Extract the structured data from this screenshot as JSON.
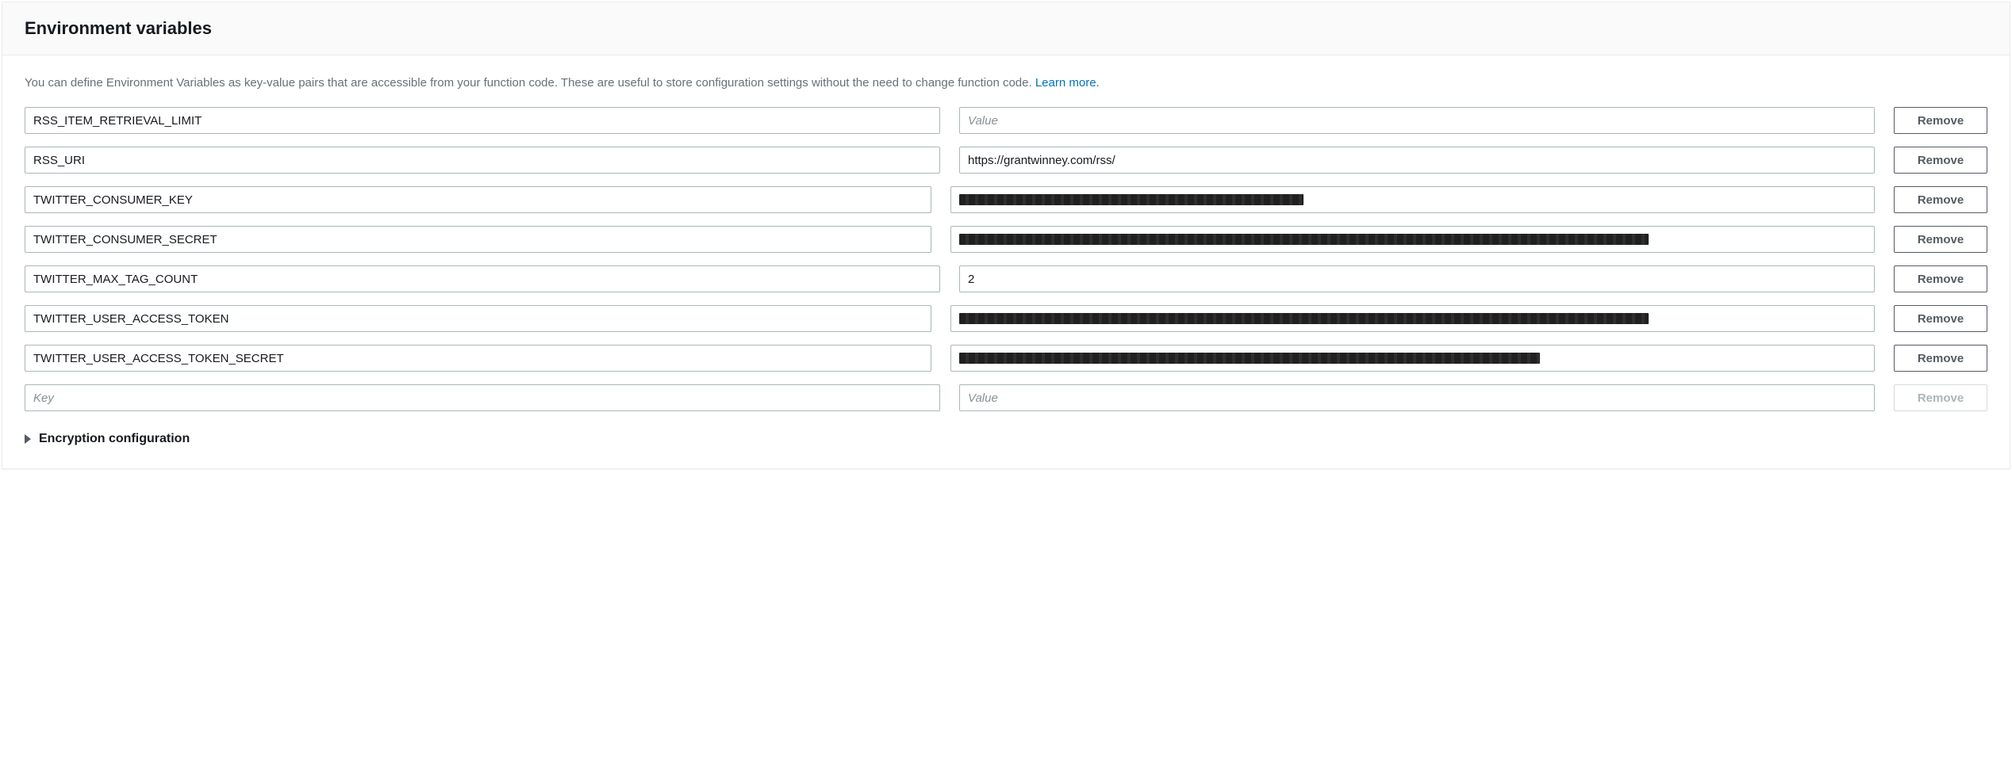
{
  "header": {
    "title": "Environment variables"
  },
  "description": {
    "text": "You can define Environment Variables as key-value pairs that are accessible from your function code. These are useful to store configuration settings without the need to change function code. ",
    "link_text": "Learn more."
  },
  "placeholders": {
    "key": "Key",
    "value": "Value"
  },
  "buttons": {
    "remove": "Remove"
  },
  "rows": [
    {
      "key": "RSS_ITEM_RETRIEVAL_LIMIT",
      "value": "",
      "redacted": false,
      "redacted_width": 0
    },
    {
      "key": "RSS_URI",
      "value": "https://grantwinney.com/rss/",
      "redacted": false,
      "redacted_width": 0
    },
    {
      "key": "TWITTER_CONSUMER_KEY",
      "value": "",
      "redacted": true,
      "redacted_width": 38
    },
    {
      "key": "TWITTER_CONSUMER_SECRET",
      "value": "",
      "redacted": true,
      "redacted_width": 76
    },
    {
      "key": "TWITTER_MAX_TAG_COUNT",
      "value": "2",
      "redacted": false,
      "redacted_width": 0
    },
    {
      "key": "TWITTER_USER_ACCESS_TOKEN",
      "value": "",
      "redacted": true,
      "redacted_width": 76
    },
    {
      "key": "TWITTER_USER_ACCESS_TOKEN_SECRET",
      "value": "",
      "redacted": true,
      "redacted_width": 64
    }
  ],
  "empty_row": {
    "enabled": false
  },
  "expander": {
    "label": "Encryption configuration"
  }
}
